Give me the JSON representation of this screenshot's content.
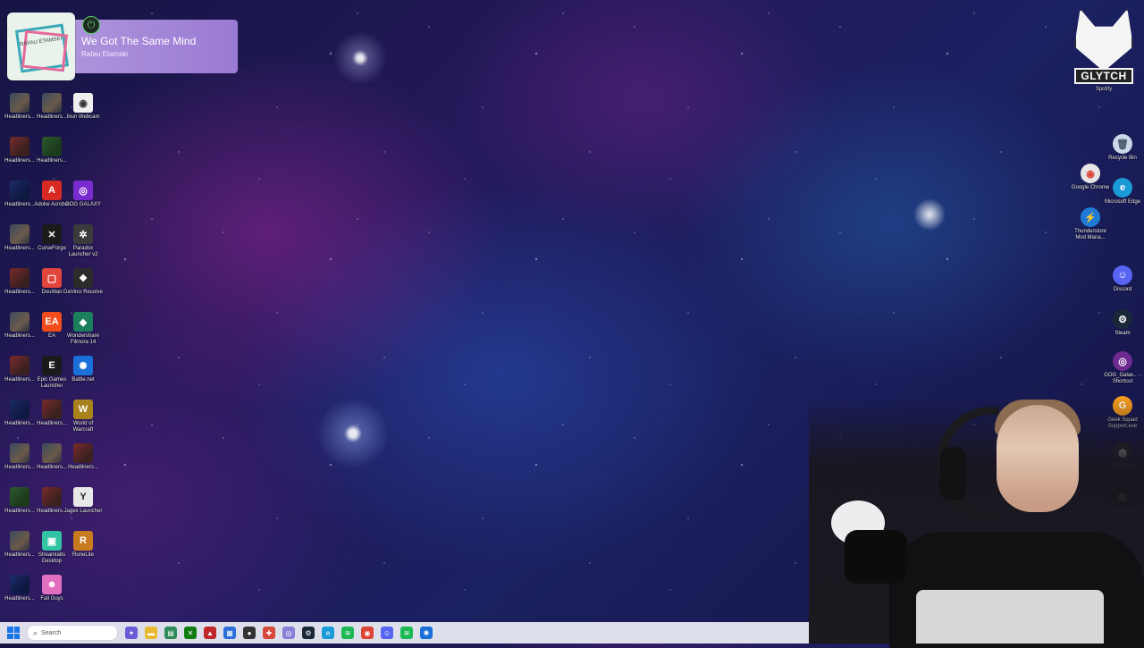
{
  "now_playing": {
    "title": "We Got The Same Mind",
    "artist": "Rafau Etamski",
    "album_text": "RAFAU ETAMSKI"
  },
  "overlay": {
    "logo_text": "GLYTCH",
    "logo_sub": "Spotify"
  },
  "desktop_left": [
    {
      "label": "Headliners...",
      "kind": "thumb"
    },
    {
      "label": "Headliners...",
      "kind": "thumb"
    },
    {
      "label": "Iriun Webcam",
      "kind": "app",
      "icon": "webcam-icon",
      "color": "#f0f0f0",
      "glyph": "◉",
      "fg": "#333"
    },
    {
      "label": "Headliners...",
      "kind": "thumb r"
    },
    {
      "label": "Headliners...",
      "kind": "thumb g"
    },
    {
      "label": "Headliners...",
      "kind": "thumb b"
    },
    {
      "label": "Adobe Acrobat",
      "kind": "app",
      "icon": "acrobat-icon",
      "color": "#d62a22",
      "glyph": "A"
    },
    {
      "label": "GOG GALAXY",
      "kind": "app",
      "icon": "gog-galaxy-icon",
      "color": "#7a2bd0",
      "glyph": "◎"
    },
    {
      "label": "Headliners...",
      "kind": "thumb"
    },
    {
      "label": "CurseForge",
      "kind": "app",
      "icon": "curseforge-icon",
      "color": "#1a1a1a",
      "glyph": "✕"
    },
    {
      "label": "Paradox Launcher v2",
      "kind": "app",
      "icon": "paradox-icon",
      "color": "#3a3a3a",
      "glyph": "✲"
    },
    {
      "label": "Headliners...",
      "kind": "thumb r"
    },
    {
      "label": "DouWan",
      "kind": "app",
      "icon": "douwan-icon",
      "color": "#e2453b",
      "glyph": "▢"
    },
    {
      "label": "DaVinci Resolve",
      "kind": "app",
      "icon": "davinci-resolve-icon",
      "color": "#2b2b2b",
      "glyph": "❖"
    },
    {
      "label": "Headliners...",
      "kind": "thumb"
    },
    {
      "label": "EA",
      "kind": "app",
      "icon": "ea-icon",
      "color": "#f24c1c",
      "glyph": "EA"
    },
    {
      "label": "Wondershare Filmora 14",
      "kind": "app",
      "icon": "filmora-icon",
      "color": "#1b7f5e",
      "glyph": "◆"
    },
    {
      "label": "Headliners...",
      "kind": "thumb r"
    },
    {
      "label": "Epic Games Launcher",
      "kind": "app",
      "icon": "epic-games-icon",
      "color": "#1a1a1a",
      "glyph": "E"
    },
    {
      "label": "Battle.net",
      "kind": "app",
      "icon": "battlenet-icon",
      "color": "#1a6fd8",
      "glyph": "✺"
    },
    {
      "label": "Headliners...",
      "kind": "thumb b"
    },
    {
      "label": "Headliners...",
      "kind": "thumb r"
    },
    {
      "label": "World of Warcraft",
      "kind": "app",
      "icon": "wow-icon",
      "color": "#a8821c",
      "glyph": "W"
    },
    {
      "label": "Headliners...",
      "kind": "thumb"
    },
    {
      "label": "Headliners...",
      "kind": "thumb"
    },
    {
      "label": "Headliners...",
      "kind": "thumb r"
    },
    {
      "label": "Headliners...",
      "kind": "thumb g"
    },
    {
      "label": "Headliners...",
      "kind": "thumb r"
    },
    {
      "label": "Jagex Launcher",
      "kind": "app",
      "icon": "jagex-icon",
      "color": "#e8e8e8",
      "glyph": "Y",
      "fg": "#222"
    },
    {
      "label": "Headliners...",
      "kind": "thumb"
    },
    {
      "label": "Streamlabs Desktop",
      "kind": "app",
      "icon": "streamlabs-icon",
      "color": "#31c3a2",
      "glyph": "▣"
    },
    {
      "label": "RuneLite",
      "kind": "app",
      "icon": "runelite-icon",
      "color": "#c87a1e",
      "glyph": "R"
    },
    {
      "label": "Headliners...",
      "kind": "thumb b"
    },
    {
      "label": "Fall Guys",
      "kind": "app",
      "icon": "fall-guys-icon",
      "color": "#e26fc0",
      "glyph": "☻"
    }
  ],
  "desktop_right": [
    {
      "label": "Recycle Bin",
      "icon": "recycle-bin-icon",
      "color": "#c9d7e8",
      "glyph": "🗑",
      "fg": "#456"
    },
    {
      "label": "Google Chrome",
      "icon": "chrome-icon",
      "color": "#e5e5e5",
      "glyph": "◉",
      "fg": "#db4437"
    },
    {
      "label": "Microsoft Edge",
      "icon": "edge-icon",
      "color": "#1a9ad6",
      "glyph": "e"
    },
    {
      "label": "Thunderstore Mod Mana...",
      "icon": "thunderstore-icon",
      "color": "#1f7bd6",
      "glyph": "⚡"
    },
    {
      "label": "Discord",
      "icon": "discord-icon",
      "color": "#5865f2",
      "glyph": "☺"
    },
    {
      "label": "Steam",
      "icon": "steam-icon",
      "color": "#1b2838",
      "glyph": "⚙"
    },
    {
      "label": "GOG_Galax... - Shortcut",
      "icon": "gog-shortcut-icon",
      "color": "#6e2a90",
      "glyph": "◎"
    },
    {
      "label": "Geek Squad Support.exe",
      "icon": "geek-squad-icon",
      "color": "#f39c1e",
      "glyph": "G"
    },
    {
      "label": "OBS Studio",
      "icon": "obs-icon",
      "color": "#2a2a2a",
      "glyph": "◍"
    },
    {
      "label": "Stream Deck",
      "icon": "stream-deck-icon",
      "color": "#1a1a1a",
      "glyph": "▦"
    }
  ],
  "taskbar": {
    "search_placeholder": "Search",
    "apps": [
      {
        "name": "taskbar-copilot-icon",
        "color": "#6b5bd6",
        "glyph": "✦"
      },
      {
        "name": "taskbar-file-explorer-icon",
        "color": "#e9b92e",
        "glyph": "▬"
      },
      {
        "name": "taskbar-app-green-icon",
        "color": "#2e8b57",
        "glyph": "▤"
      },
      {
        "name": "taskbar-xbox-icon",
        "color": "#107c10",
        "glyph": "✕"
      },
      {
        "name": "taskbar-app-red-icon",
        "color": "#c0272d",
        "glyph": "▲"
      },
      {
        "name": "taskbar-store-icon",
        "color": "#2b6ed9",
        "glyph": "▦"
      },
      {
        "name": "taskbar-obs-icon",
        "color": "#333",
        "glyph": "●"
      },
      {
        "name": "taskbar-app-multi-icon",
        "color": "#d6483a",
        "glyph": "✚"
      },
      {
        "name": "taskbar-app-purple-icon",
        "color": "#8a7fd6",
        "glyph": "◎"
      },
      {
        "name": "taskbar-steam-icon",
        "color": "#1b2838",
        "glyph": "⚙"
      },
      {
        "name": "taskbar-edge-icon",
        "color": "#1a9ad6",
        "glyph": "e"
      },
      {
        "name": "taskbar-spotify-icon",
        "color": "#1db954",
        "glyph": "≋"
      },
      {
        "name": "taskbar-chrome-icon",
        "color": "#db4437",
        "glyph": "◉"
      },
      {
        "name": "taskbar-discord-icon",
        "color": "#5865f2",
        "glyph": "☺"
      },
      {
        "name": "taskbar-spotify2-icon",
        "color": "#1db954",
        "glyph": "≋"
      },
      {
        "name": "taskbar-battlenet-icon",
        "color": "#1a6fd8",
        "glyph": "✺"
      }
    ]
  }
}
